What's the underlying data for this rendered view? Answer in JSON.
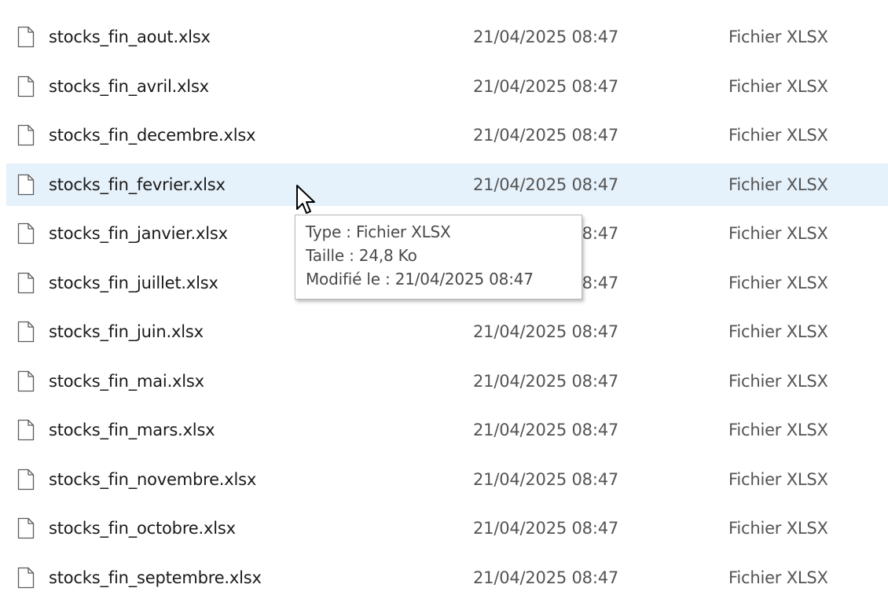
{
  "files": [
    {
      "name": "stocks_fin_aout.xlsx",
      "modified": "21/04/2025 08:47",
      "type": "Fichier XLSX",
      "hovered": false
    },
    {
      "name": "stocks_fin_avril.xlsx",
      "modified": "21/04/2025 08:47",
      "type": "Fichier XLSX",
      "hovered": false
    },
    {
      "name": "stocks_fin_decembre.xlsx",
      "modified": "21/04/2025 08:47",
      "type": "Fichier XLSX",
      "hovered": false
    },
    {
      "name": "stocks_fin_fevrier.xlsx",
      "modified": "21/04/2025 08:47",
      "type": "Fichier XLSX",
      "hovered": true
    },
    {
      "name": "stocks_fin_janvier.xlsx",
      "modified": "21/04/2025 08:47",
      "type": "Fichier XLSX",
      "hovered": false
    },
    {
      "name": "stocks_fin_juillet.xlsx",
      "modified": "21/04/2025 08:47",
      "type": "Fichier XLSX",
      "hovered": false
    },
    {
      "name": "stocks_fin_juin.xlsx",
      "modified": "21/04/2025 08:47",
      "type": "Fichier XLSX",
      "hovered": false
    },
    {
      "name": "stocks_fin_mai.xlsx",
      "modified": "21/04/2025 08:47",
      "type": "Fichier XLSX",
      "hovered": false
    },
    {
      "name": "stocks_fin_mars.xlsx",
      "modified": "21/04/2025 08:47",
      "type": "Fichier XLSX",
      "hovered": false
    },
    {
      "name": "stocks_fin_novembre.xlsx",
      "modified": "21/04/2025 08:47",
      "type": "Fichier XLSX",
      "hovered": false
    },
    {
      "name": "stocks_fin_octobre.xlsx",
      "modified": "21/04/2025 08:47",
      "type": "Fichier XLSX",
      "hovered": false
    },
    {
      "name": "stocks_fin_septembre.xlsx",
      "modified": "21/04/2025 08:47",
      "type": "Fichier XLSX",
      "hovered": false
    }
  ],
  "tooltip": {
    "type_line": "Type : Fichier XLSX",
    "size_line": "Taille : 24,8 Ko",
    "modified_line": "Modifié le : 21/04/2025 08:47"
  },
  "icons": {
    "file": "file-icon",
    "cursor": "mouse-pointer-icon"
  },
  "colors": {
    "hover_background": "#e5f1fb",
    "secondary_text": "#545454",
    "tooltip_border": "#b9b9b9"
  }
}
